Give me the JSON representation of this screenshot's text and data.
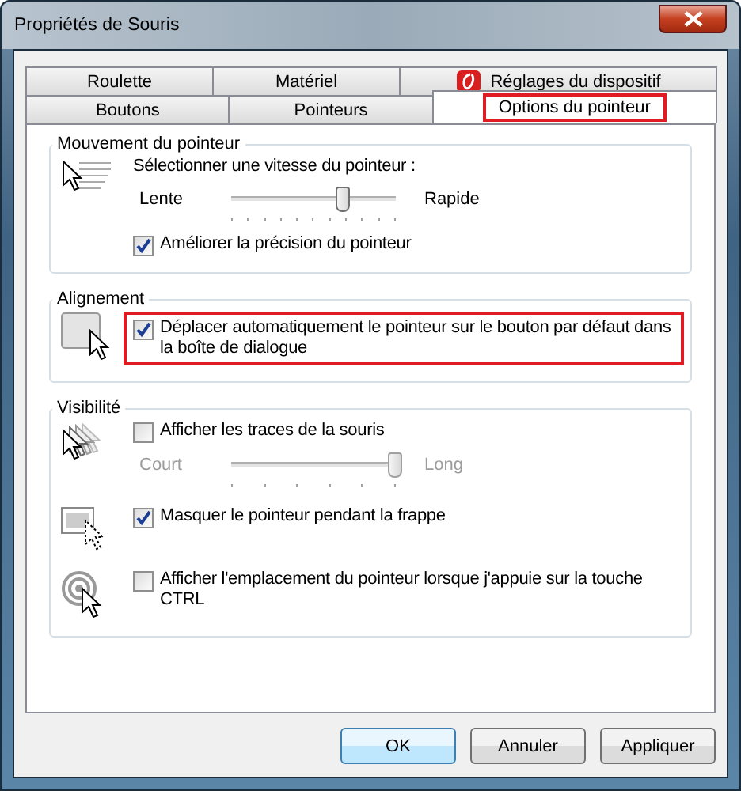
{
  "window": {
    "title": "Propriétés de Souris"
  },
  "tab_rows": [
    [
      {
        "label": "Roulette",
        "selected": false,
        "has_icon": false,
        "highlighted": false
      },
      {
        "label": "Matériel",
        "selected": false,
        "has_icon": false,
        "highlighted": false
      },
      {
        "label": "Réglages du dispositif",
        "selected": false,
        "has_icon": true,
        "highlighted": false
      }
    ],
    [
      {
        "label": "Boutons",
        "selected": false,
        "has_icon": false,
        "highlighted": false
      },
      {
        "label": "Pointeurs",
        "selected": false,
        "has_icon": false,
        "highlighted": false
      },
      {
        "label": "Options du pointeur",
        "selected": true,
        "has_icon": false,
        "highlighted": true
      }
    ]
  ],
  "groups": [
    {
      "title": "Mouvement du pointeur",
      "sections": [
        {
          "kind": "speed",
          "rows": [
            {
              "kind": "label",
              "text": "Sélectionner une vitesse du pointeur :"
            },
            {
              "kind": "slider",
              "min_label": "Lente",
              "max_label": "Rapide",
              "level": 0.68,
              "disabled": false
            },
            {
              "kind": "checkbox",
              "label": "Améliorer la précision du pointeur",
              "checked": true,
              "highlighted": false
            }
          ]
        }
      ]
    },
    {
      "title": "Alignement",
      "sections": [
        {
          "kind": "button",
          "rows": [
            {
              "kind": "checkbox",
              "label": "Déplacer automatiquement le pointeur sur le bouton par défaut dans la boîte de dialogue",
              "checked": true,
              "highlighted": true
            }
          ]
        }
      ]
    },
    {
      "title": "Visibilité",
      "sections": [
        {
          "kind": "trails",
          "rows": [
            {
              "kind": "checkbox",
              "label": "Afficher les traces de la souris",
              "checked": false,
              "highlighted": false
            },
            {
              "kind": "slider",
              "min_label": "Court",
              "max_label": "Long",
              "level": 1,
              "disabled": true
            }
          ]
        },
        {
          "kind": "hide",
          "rows": [
            {
              "kind": "checkbox",
              "label": "Masquer le pointeur pendant la frappe",
              "checked": true,
              "highlighted": false
            }
          ]
        },
        {
          "kind": "locate",
          "rows": [
            {
              "kind": "checkbox",
              "label": "Afficher l'emplacement du pointeur lorsque j'appuie sur la touche CTRL",
              "checked": false,
              "highlighted": false
            }
          ]
        }
      ]
    }
  ],
  "buttons": [
    {
      "label": "OK",
      "default": true
    },
    {
      "label": "Annuler",
      "default": false
    },
    {
      "label": "Appliquer",
      "default": false
    }
  ]
}
